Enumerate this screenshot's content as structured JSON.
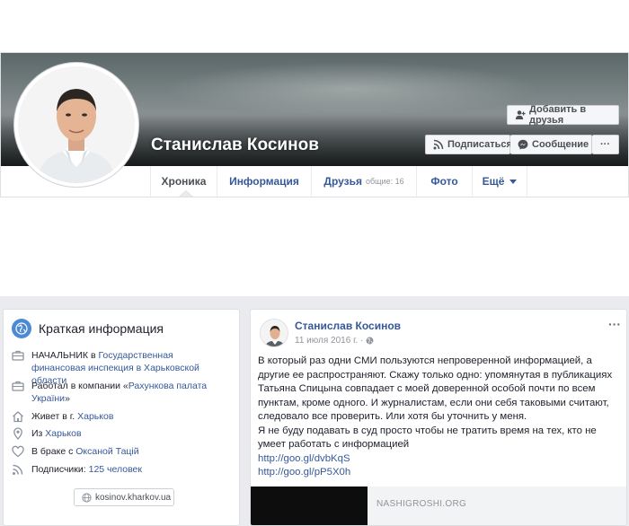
{
  "profile": {
    "name": "Станислав Косинов"
  },
  "actions": {
    "add_friend": "Добавить в друзья",
    "subscribe": "Подписаться",
    "message": "Сообщение",
    "more": "···"
  },
  "tabs": [
    {
      "label": "Хроника",
      "active": true
    },
    {
      "label": "Информация"
    },
    {
      "label": "Друзья",
      "sub": "общие: 16"
    },
    {
      "label": "Фото"
    },
    {
      "label": "Ещё"
    }
  ],
  "intro": {
    "title": "Краткая информация",
    "job": {
      "prefix": "НАЧАЛЬНИК в ",
      "org": "Государственная финансовая инспекция в Харьковской области"
    },
    "worked": {
      "prefix": "Работал в компании «",
      "org": "Рахункова палата України",
      "suffix": "»"
    },
    "lives": {
      "prefix": "Живет в г. ",
      "city": "Харьков"
    },
    "from": {
      "prefix": "Из ",
      "city": "Харьков"
    },
    "married": {
      "prefix": "В браке с ",
      "person": "Оксаной Тацій"
    },
    "followers": {
      "prefix": "Подписчики: ",
      "count": "125 человек"
    },
    "website": "kosinov.kharkov.ua"
  },
  "post": {
    "author": "Станислав Косинов",
    "date": "11 июля 2016 г. ·",
    "more": "···",
    "paragraph1": "В который раз одни СМИ пользуются непроверенной информацией, а другие ее распространяют. Скажу только одно: упомянутая в публикациях Татьяна Спицына совпадает с моей доверенной особой почти по всем пунктам, кроме одного. И журналистам, если они себя таковыми считают, следовало все проверить. Или хотя бы уточнить у меня.",
    "paragraph2": "Я не буду подавать в суд просто чтобы не тратить время на тех, кто не умеет работать с информацией",
    "link1": "http://goo.gl/dvbKqS",
    "link2": "http://goo.gl/pP5X0h",
    "source": "NASHIGROSHI.ORG"
  },
  "colors": {
    "link": "#365899",
    "page_bg": "#e9ebee",
    "border": "#dddfe2"
  }
}
